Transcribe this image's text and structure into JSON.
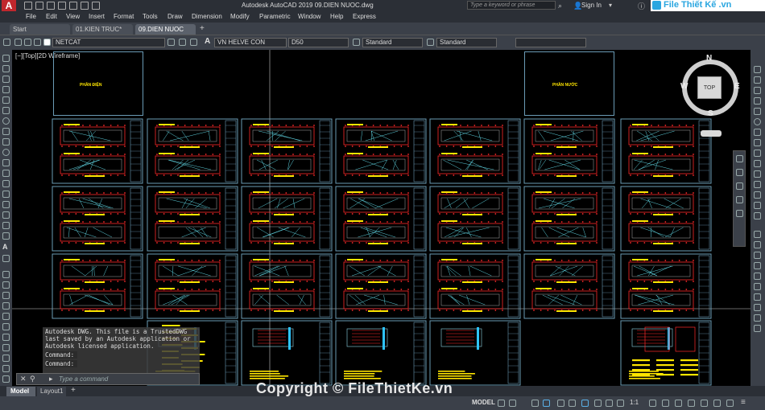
{
  "app": {
    "title": "Autodesk AutoCAD 2019   09.DIEN NUOC.dwg",
    "search_placeholder": "Type a keyword or phrase",
    "sign_in": "Sign In"
  },
  "brand": {
    "name": "File Thiết Kế .vn"
  },
  "menu": [
    "File",
    "Edit",
    "View",
    "Insert",
    "Format",
    "Tools",
    "Draw",
    "Dimension",
    "Modify",
    "Parametric",
    "Window",
    "Help",
    "Express"
  ],
  "doc_tabs": [
    "Start",
    "01.KIEN TRUC*",
    "09.DIEN NUOC"
  ],
  "toolbar": {
    "layer": "NETCAT",
    "text_style": "VN HELVE CON",
    "dim_style": "D50",
    "table_style": "Standard",
    "multileader_style": "Standard"
  },
  "viewport": {
    "label": "[−][Top][2D Wireframe]",
    "title_left": "PHẦN ĐIỆN",
    "title_right": "PHẦN NƯỚC"
  },
  "compass": {
    "n": "N",
    "s": "S",
    "e": "E",
    "w": "W",
    "top": "TOP"
  },
  "command": {
    "history": [
      "Autodesk DWG.  This file is a TrustedDWG",
      "last saved by an Autodesk application or",
      "Autodesk licensed application.",
      "Command:",
      "Command:"
    ],
    "placeholder": "Type a command"
  },
  "layout_tabs": [
    "Model",
    "Layout1"
  ],
  "status": {
    "model": "MODEL",
    "scale": "1:1"
  },
  "watermark": "Copyright © FileThietKe.vn",
  "colors": {
    "bg": "#000000",
    "sheet_border": "#6a9bb5",
    "accent_red": "#c0272d",
    "drawing_red": "#ff2a2a",
    "drawing_yellow": "#ffe600"
  }
}
